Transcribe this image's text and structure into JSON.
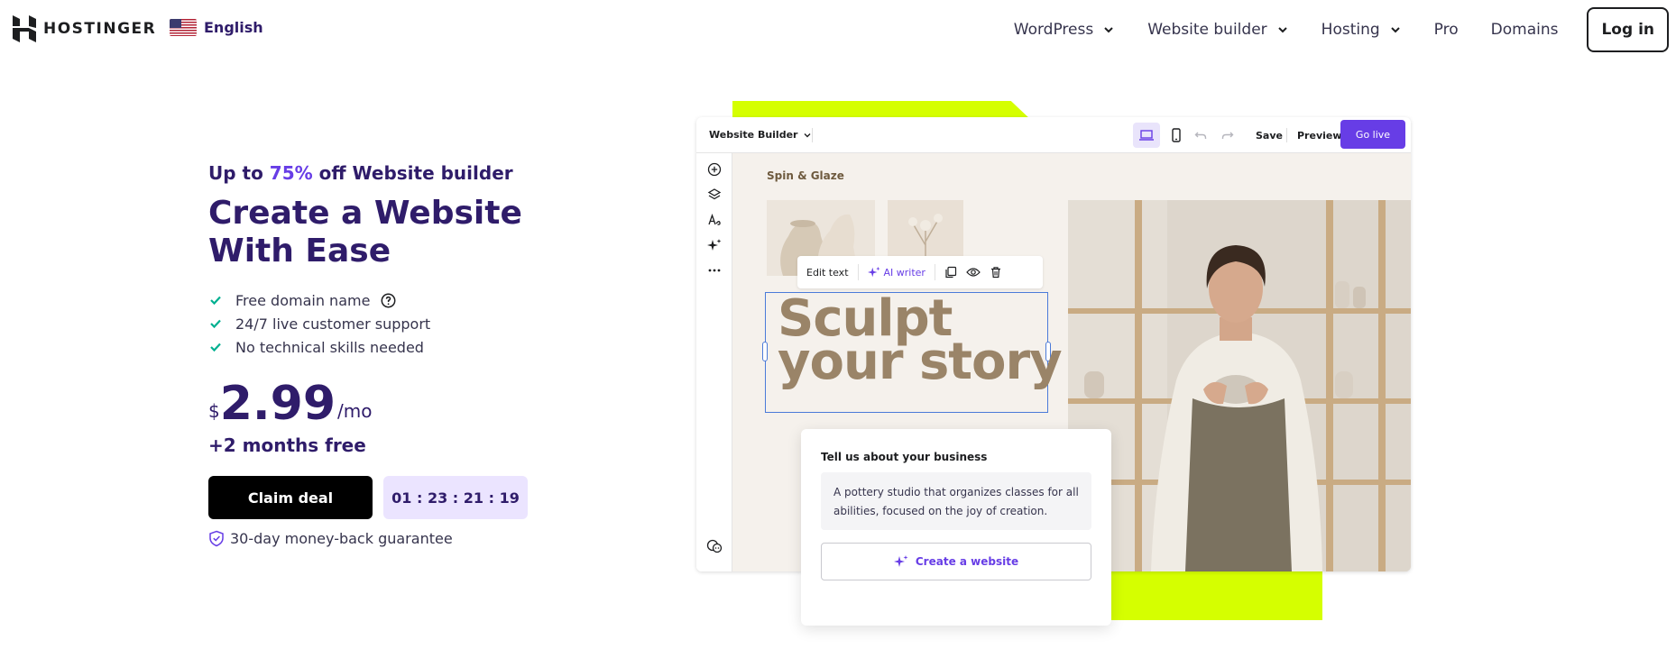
{
  "nav": {
    "brand": "HOSTINGER",
    "language": "English",
    "menu": [
      {
        "label": "WordPress",
        "dropdown": true
      },
      {
        "label": "Website builder",
        "dropdown": true
      },
      {
        "label": "Hosting",
        "dropdown": true
      },
      {
        "label": "Pro",
        "dropdown": false
      },
      {
        "label": "Domains",
        "dropdown": false
      }
    ],
    "login": "Log in"
  },
  "hero": {
    "promo_prefix": "Up to ",
    "promo_pct": "75%",
    "promo_suffix": " off Website builder",
    "title": "Create a Website With Ease",
    "features": [
      "Free domain name",
      "24/7 live customer support",
      "No technical skills needed"
    ],
    "price_currency": "$",
    "price_amount": "2.99",
    "price_period": "/mo",
    "bonus": "+2 months free",
    "cta": "Claim deal",
    "timer": "01 : 23 : 21 : 19",
    "guarantee": "30-day money-back guarantee"
  },
  "builder": {
    "title": "Website Builder",
    "save": "Save",
    "preview": "Preview",
    "go_live": "Go live",
    "site_name": "Spin & Glaze",
    "edit_text": "Edit text",
    "ai_writer": "AI writer",
    "headline_line1": "Sculpt",
    "headline_line2": "your story"
  },
  "card": {
    "title": "Tell us about your business",
    "text": "A pottery studio that organizes classes for all abilities, focused on the joy of creation.",
    "button": "Create a website"
  },
  "colors": {
    "accent": "#673de6",
    "navy": "#2f1c6a",
    "lime": "#d5ff00",
    "check": "#00b090",
    "timer_bg": "#ebe4ff"
  }
}
